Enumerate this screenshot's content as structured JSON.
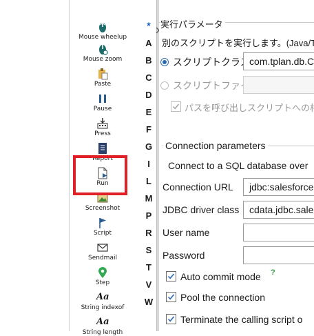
{
  "toolbar": {
    "items": [
      {
        "label": "Mouse wheelup",
        "icon": "mouse-wheel-icon"
      },
      {
        "label": "Mouse zoom",
        "icon": "mouse-zoom-icon"
      },
      {
        "label": "Paste",
        "icon": "paste-icon"
      },
      {
        "label": "Pause",
        "icon": "pause-icon"
      },
      {
        "label": "Press",
        "icon": "press-icon"
      },
      {
        "label": "Report",
        "icon": "report-icon"
      },
      {
        "label": "Run",
        "icon": "run-icon"
      },
      {
        "label": "Screenshot",
        "icon": "screenshot-icon"
      },
      {
        "label": "Script",
        "icon": "script-flag-icon"
      },
      {
        "label": "Sendmail",
        "icon": "mail-icon"
      },
      {
        "label": "Step",
        "icon": "step-pin-icon"
      },
      {
        "label": "String indexof",
        "icon": "string-icon"
      },
      {
        "label": "String length",
        "icon": "string-icon"
      }
    ],
    "highlight_color": "#e01f26"
  },
  "index_letters": [
    "*",
    "A",
    "B",
    "C",
    "D",
    "E",
    "F",
    "G",
    "I",
    "L",
    "M",
    "P",
    "R",
    "S",
    "T",
    "V",
    "W"
  ],
  "main": {
    "section_title": "実行パラメータ",
    "description": "別のスクリプトを実行します。(Java/TP",
    "radio_script_class": "スクリプトクラス",
    "script_class_value": "com.tplan.db.C",
    "radio_script_file": "スクリプトファイル",
    "path_checkbox_label": "パスを呼び出しスクリプトへの相対",
    "conn_group_title": "Connection parameters",
    "conn_description": "Connect to a SQL database over",
    "url_label": "Connection URL",
    "url_value": "jdbc:salesforce",
    "driver_label": "JDBC driver class",
    "driver_value": "cdata.jdbc.sale",
    "user_label": "User name",
    "user_value": "",
    "password_label": "Password",
    "password_value": "",
    "auto_commit_label": "Auto commit mode",
    "auto_commit_help": "?",
    "pool_label": "Pool the connection",
    "terminate_label": "Terminate the calling script o"
  }
}
